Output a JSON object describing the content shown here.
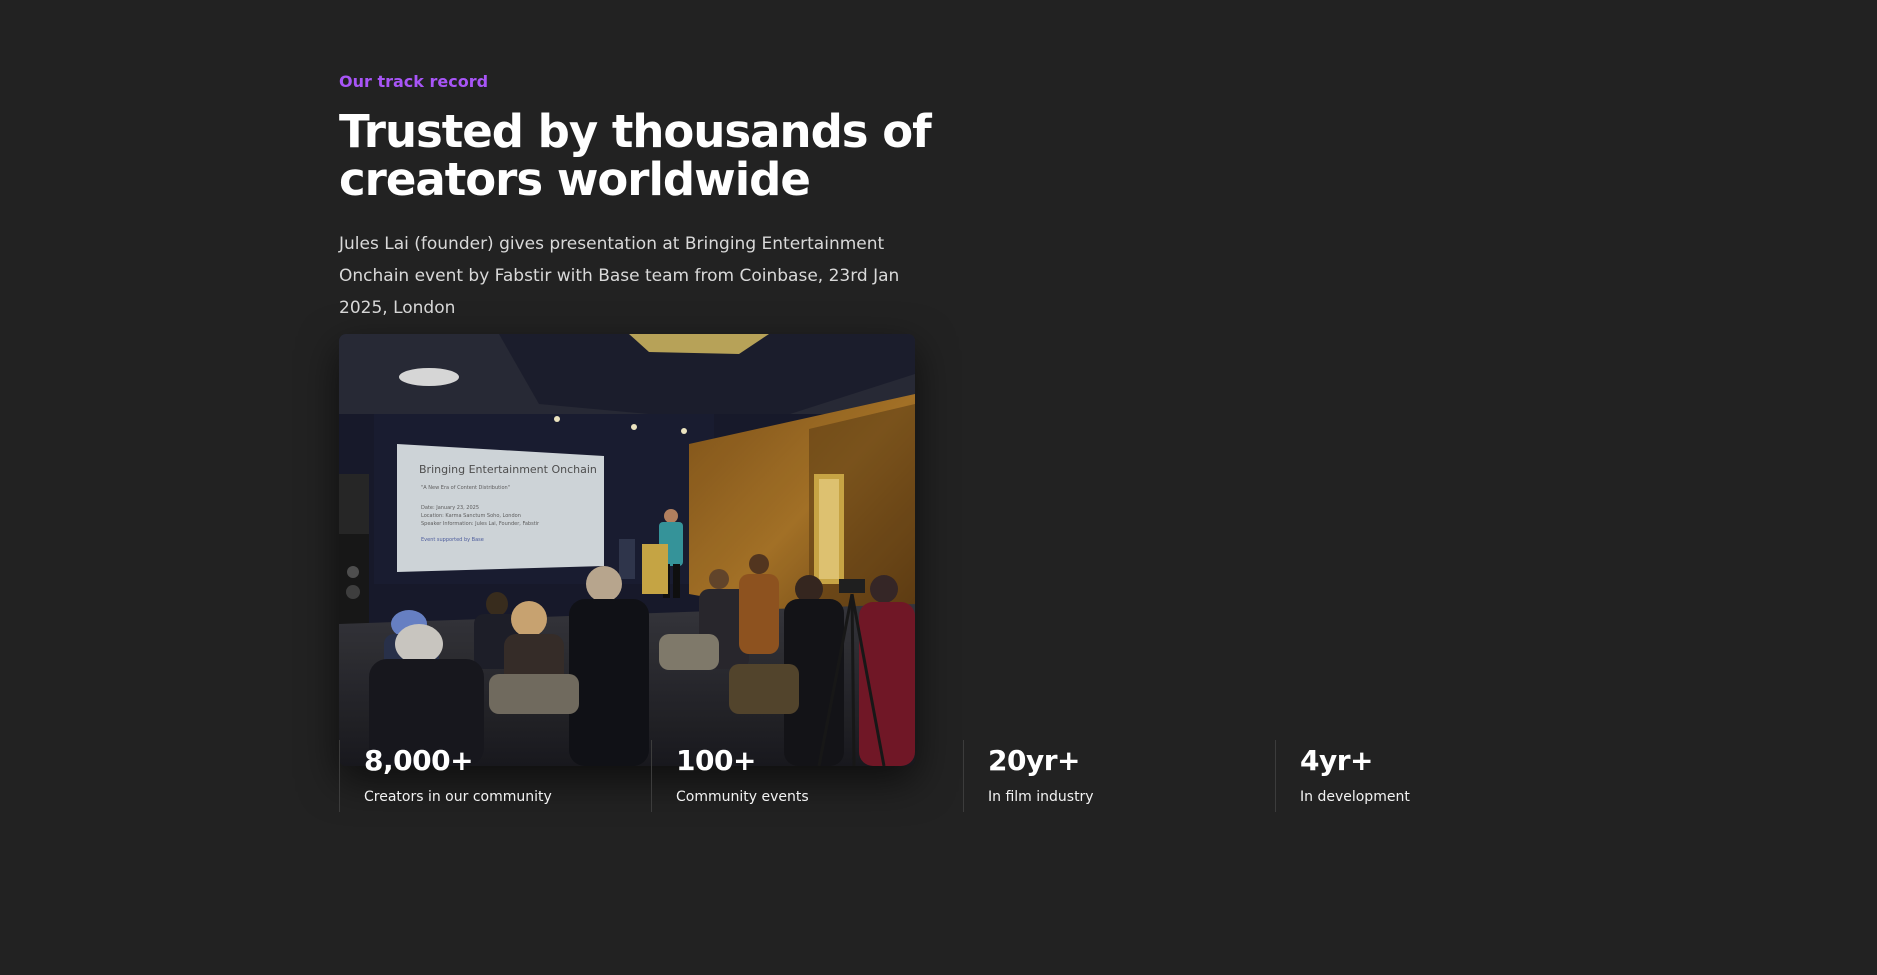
{
  "track_record": {
    "eyebrow": "Our track record",
    "headline": "Trusted by thousands of creators worldwide",
    "caption": "Jules Lai (founder) gives presentation at Bringing Entertainment Onchain event by Fabstir with Base team from Coinbase, 23rd Jan 2025, London",
    "photo": {
      "screen_title": "Bringing Entertainment Onchain",
      "screen_subtitle": "\"A New Era of Content Distribution\"",
      "screen_line1": "Date: January 23, 2025",
      "screen_line2": "Location: Karma Sanctum Soho, London",
      "screen_line3": "Speaker Information: Jules Lai, Founder, Fabstir",
      "screen_line4": "Event supported by Base"
    }
  },
  "stats": [
    {
      "value": "8,000+",
      "label": "Creators in our community"
    },
    {
      "value": "100+",
      "label": "Community events"
    },
    {
      "value": "20yr+",
      "label": "In film industry"
    },
    {
      "value": "4yr+",
      "label": "In development"
    }
  ],
  "colors": {
    "background": "#222222",
    "accent": "#a855f7",
    "divider": "#3c3c3c"
  }
}
